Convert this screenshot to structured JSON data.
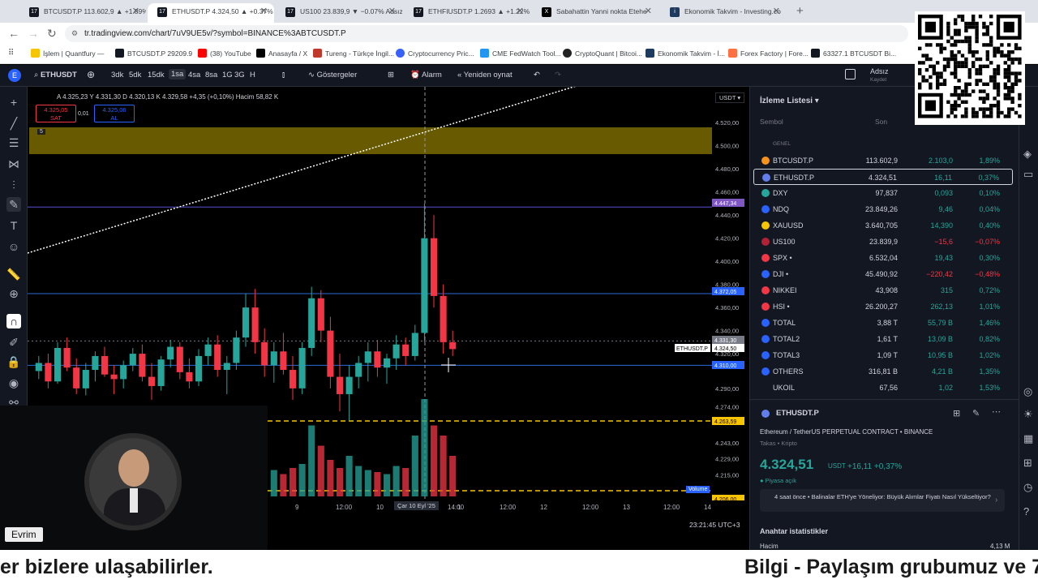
{
  "browser": {
    "tabs": [
      {
        "label": "BTCUSDT.P 113.602,9 ▲ +1.89%",
        "active": false,
        "icon": "tradingview-icon"
      },
      {
        "label": "ETHUSDT.P 4.324,50 ▲ +0.37%",
        "active": true,
        "icon": "tradingview-icon"
      },
      {
        "label": "US100 23.839,9 ▼ −0.07% Adsız",
        "active": false,
        "icon": "tradingview-icon"
      },
      {
        "label": "ETHFIUSDT.P 1.2693 ▲ +1.22%",
        "active": false,
        "icon": "tradingview-icon"
      },
      {
        "label": "Sabahattin Yanni nokta Etehe",
        "active": false,
        "icon": "x-icon"
      },
      {
        "label": "Ekonomik Takvim - Investing.co",
        "active": false,
        "icon": "investing-icon"
      }
    ],
    "url": "tr.tradingview.com/chart/7uV9UE5v/?symbol=BINANCE%3ABTCUSDT.P",
    "bookmarks": [
      "İşlem | Quantfury —",
      "BTCUSDT.P 29209.9",
      "(38) YouTube",
      "Anasayfa / X",
      "Tureng - Türkçe İngil...",
      "Cryptocurrency Pric...",
      "CME FedWatch Tool...",
      "CryptoQuant | Bitcoi...",
      "Ekonomik Takvim - İ...",
      "Forex Factory | Fore...",
      "63327.1 BTCUSDT Bi..."
    ]
  },
  "header": {
    "symbol": "ETHUSDT",
    "intervals": [
      "3dk",
      "5dk",
      "15dk",
      "1sa",
      "4sa",
      "8sa",
      "3G",
      "H"
    ],
    "active_interval": "1sa",
    "indicators": "Göstergeler",
    "alarm": "Alarm",
    "replay": "Yeniden oynat",
    "user": "Adsız",
    "user_sub": "Kaydet"
  },
  "legend": {
    "ohlc": "A 4.325,23  Y 4.331,30  D 4.320,13  K 4.329,58 +4,35 (+0,10%)",
    "volume_label": "Hacim",
    "volume": "58,82 K",
    "sell_price": "4.325,05",
    "sell_label": "SAT",
    "spread": "0,01",
    "buy_price": "4.325,06",
    "buy_label": "AL",
    "badge": "5"
  },
  "chart_data": {
    "type": "candlestick",
    "currency": "USDT",
    "y_ticks": [
      "4.520,00",
      "4.500,00",
      "4.480,00",
      "4.460,00",
      "4.440,00",
      "4.420,00",
      "4.400,00",
      "4.380,00",
      "4.360,00",
      "4.340,00",
      "4.320,00",
      "4.290,00",
      "4.274,00",
      "4.243,00",
      "4.229,00",
      "4.215,00"
    ],
    "x_ticks": [
      "9",
      "12:00",
      "10",
      "Çar 10 Eyl '25",
      "14:00",
      "12:00",
      "12",
      "12:00",
      "13",
      "12:00",
      "14"
    ],
    "price_tags": [
      {
        "label": "4.447,34",
        "color": "#7e57c2"
      },
      {
        "label": "4.372,05",
        "color": "#2962ff"
      },
      {
        "label": "4.331,30",
        "color": "#787b86"
      },
      {
        "label": "4.324,50",
        "color": "#ffffff",
        "name": "ETHUSDT.P"
      },
      {
        "label": "4.310,00",
        "color": "#2962ff"
      },
      {
        "label": "4.263,59",
        "color": "#f7c500"
      },
      {
        "label": "4.206,00",
        "color": "#f7c500"
      }
    ],
    "volume_label": "Volume",
    "candles": [
      [
        4305,
        4318,
        4298,
        4312
      ],
      [
        4312,
        4320,
        4290,
        4296
      ],
      [
        4296,
        4330,
        4294,
        4325
      ],
      [
        4325,
        4334,
        4305,
        4308
      ],
      [
        4308,
        4316,
        4285,
        4290
      ],
      [
        4290,
        4312,
        4284,
        4306
      ],
      [
        4306,
        4322,
        4296,
        4318
      ],
      [
        4318,
        4326,
        4300,
        4302
      ],
      [
        4302,
        4310,
        4285,
        4298
      ],
      [
        4298,
        4314,
        4290,
        4310
      ],
      [
        4310,
        4325,
        4305,
        4320
      ],
      [
        4320,
        4328,
        4296,
        4300
      ],
      [
        4300,
        4312,
        4280,
        4292
      ],
      [
        4292,
        4318,
        4288,
        4315
      ],
      [
        4315,
        4332,
        4308,
        4326
      ],
      [
        4326,
        4330,
        4298,
        4304
      ],
      [
        4304,
        4316,
        4290,
        4296
      ],
      [
        4296,
        4324,
        4292,
        4318
      ],
      [
        4318,
        4334,
        4310,
        4328
      ],
      [
        4328,
        4336,
        4300,
        4306
      ],
      [
        4306,
        4318,
        4285,
        4312
      ],
      [
        4312,
        4340,
        4306,
        4334
      ],
      [
        4334,
        4372,
        4326,
        4360
      ],
      [
        4360,
        4376,
        4320,
        4330
      ],
      [
        4330,
        4342,
        4300,
        4310
      ],
      [
        4310,
        4330,
        4295,
        4322
      ],
      [
        4322,
        4338,
        4302,
        4306
      ],
      [
        4306,
        4318,
        4280,
        4290
      ],
      [
        4290,
        4330,
        4285,
        4325
      ],
      [
        4325,
        4378,
        4318,
        4368
      ],
      [
        4368,
        4375,
        4330,
        4340
      ],
      [
        4340,
        4352,
        4290,
        4300
      ],
      [
        4300,
        4320,
        4270,
        4285
      ],
      [
        4285,
        4310,
        4262,
        4300
      ],
      [
        4300,
        4318,
        4290,
        4312
      ],
      [
        4312,
        4330,
        4296,
        4322
      ],
      [
        4322,
        4332,
        4300,
        4308
      ],
      [
        4308,
        4320,
        4294,
        4316
      ],
      [
        4316,
        4336,
        4306,
        4328
      ],
      [
        4328,
        4334,
        4310,
        4318
      ],
      [
        4318,
        4345,
        4314,
        4338
      ],
      [
        4338,
        4450,
        4330,
        4420
      ],
      [
        4420,
        4440,
        4360,
        4370
      ],
      [
        4370,
        4380,
        4320,
        4330
      ],
      [
        4330,
        4340,
        4318,
        4324
      ]
    ],
    "volumes": [
      20,
      25,
      30,
      22,
      18,
      24,
      28,
      20,
      16,
      22,
      26,
      30,
      22,
      18,
      24,
      28,
      20,
      26,
      30,
      22,
      24,
      28,
      60,
      40,
      30,
      26,
      22,
      28,
      32,
      70,
      50,
      36,
      28,
      40,
      30,
      26,
      24,
      22,
      30,
      28,
      60,
      96,
      70,
      60,
      40
    ]
  },
  "drawings": {
    "zone_color": "#7a6a00"
  },
  "watchlist": {
    "title": "İzleme Listesi",
    "col_symbol": "Sembol",
    "col_last": "Son",
    "section": "GENEL",
    "rows": [
      {
        "sym": "BTCUSDT.P",
        "last": "113.602,9",
        "chg": "2.103,0",
        "pct": "1,89%",
        "dir": "pos",
        "icon": "#f7931a"
      },
      {
        "sym": "ETHUSDT.P",
        "last": "4.324,51",
        "chg": "16,11",
        "pct": "0,37%",
        "dir": "pos",
        "icon": "#627eea"
      },
      {
        "sym": "DXY",
        "last": "97,837",
        "chg": "0,093",
        "pct": "0,10%",
        "dir": "pos",
        "icon": "#26a69a"
      },
      {
        "sym": "NDQ",
        "last": "23.849,26",
        "chg": "9,46",
        "pct": "0,04%",
        "dir": "pos",
        "icon": "#2962ff"
      },
      {
        "sym": "XAUUSD",
        "last": "3.640,705",
        "chg": "14,390",
        "pct": "0,40%",
        "dir": "pos",
        "icon": "#f7c500"
      },
      {
        "sym": "US100",
        "last": "23.839,9",
        "chg": "−15,6",
        "pct": "−0,07%",
        "dir": "neg",
        "icon": "#b22234"
      },
      {
        "sym": "SPX •",
        "last": "6.532,04",
        "chg": "19,43",
        "pct": "0,30%",
        "dir": "pos",
        "icon": "#f23645"
      },
      {
        "sym": "DJI •",
        "last": "45.490,92",
        "chg": "−220,42",
        "pct": "−0,48%",
        "dir": "neg",
        "icon": "#2962ff"
      },
      {
        "sym": "NIKKEI",
        "last": "43,908",
        "chg": "315",
        "pct": "0,72%",
        "dir": "pos",
        "icon": "#f23645"
      },
      {
        "sym": "HSI •",
        "last": "26.200,27",
        "chg": "262,13",
        "pct": "1,01%",
        "dir": "pos",
        "icon": "#f23645"
      },
      {
        "sym": "TOTAL",
        "last": "3,88 T",
        "chg": "55,79 B",
        "pct": "1,46%",
        "dir": "pos",
        "icon": "#2962ff"
      },
      {
        "sym": "TOTAL2",
        "last": "1,61 T",
        "chg": "13,09 B",
        "pct": "0,82%",
        "dir": "pos",
        "icon": "#2962ff"
      },
      {
        "sym": "TOTAL3",
        "last": "1,09 T",
        "chg": "10,95 B",
        "pct": "1,02%",
        "dir": "pos",
        "icon": "#2962ff"
      },
      {
        "sym": "OTHERS",
        "last": "316,81 B",
        "chg": "4,21 B",
        "pct": "1,35%",
        "dir": "pos",
        "icon": "#2962ff"
      },
      {
        "sym": "UKOIL",
        "last": "67,56",
        "chg": "1,02",
        "pct": "1,53%",
        "dir": "pos",
        "icon": "#131722"
      }
    ]
  },
  "details": {
    "symbol": "ETHUSDT.P",
    "name": "Ethereum / TetherUS PERPETUAL CONTRACT",
    "exchange": "BINANCE",
    "category": "Takas • Kripto",
    "price": "4.324,51",
    "unit": "USDT",
    "change": "+16,11",
    "pct": "+0,37%",
    "market": "Piyasa açık",
    "news_time": "4 saat önce",
    "news": "Balinalar ETH'ye Yöneliyor: Büyük Alımlar Fiyatı Nasıl Yükseltiyor?",
    "stats_title": "Anahtar istatistikler",
    "volume_label": "Hacim",
    "volume": "4,13 M"
  },
  "statusbar": {
    "time": "23:21:45 UTC+3"
  },
  "webcam": {
    "name": "Evrim"
  },
  "ticker": {
    "left": "er bizlere ulaşabilirler.",
    "right": "Bilgi - Paylaşım grubumuz ve 7"
  }
}
